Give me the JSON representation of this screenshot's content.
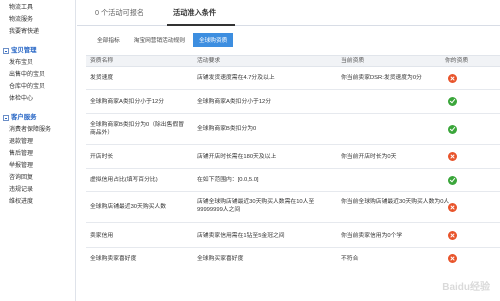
{
  "sidebar": {
    "top_items": [
      "物流工具",
      "物流服务",
      "我要寄快递"
    ],
    "sections": [
      {
        "title": "宝贝管理",
        "items": [
          "发布宝贝",
          "出售中的宝贝",
          "仓库中的宝贝",
          "体检中心"
        ]
      },
      {
        "title": "客户服务",
        "items": [
          "消费者保障服务",
          "退款管理",
          "售后管理",
          "举报管理",
          "咨询回复",
          "违规记录",
          "维权进度"
        ]
      }
    ]
  },
  "tabs": [
    {
      "label": "0 个活动可报名"
    },
    {
      "label": "活动准入条件"
    }
  ],
  "subtabs": [
    {
      "label": "全部指标"
    },
    {
      "label": "淘宝网营销活动规则"
    },
    {
      "label": "全球购资质"
    }
  ],
  "table": {
    "headers": [
      "资质名称",
      "活动要求",
      "当前资质",
      "你的资质"
    ],
    "rows": [
      {
        "name": "发货速度",
        "req": "店铺发货速度需在4.7分及以上",
        "cur": "你当前卖家DSR:发货速度为0分",
        "status": "bad"
      },
      {
        "name": "全球购商家A类扣分小于12分",
        "req": "全球购商家A类扣分小于12分",
        "cur": "",
        "status": "ok"
      },
      {
        "name": "全球购商家B类扣分为0（除出售假冒商品外）",
        "req": "全球购商家B类扣分为0",
        "cur": "",
        "status": "ok"
      },
      {
        "name": "开店时长",
        "req": "店铺开店时长需在180天及以上",
        "cur": "你当前开店时长为0天",
        "status": "bad"
      },
      {
        "name": "虚拟信用占比(填写百分比)",
        "req": "在如下范围内：[0.0,5.0]",
        "cur": "",
        "status": "ok"
      },
      {
        "name": "全球购店铺最近30天购买人数",
        "req": "店铺全球购店铺最近30天购买人数需在10人至99999999人之间",
        "cur": "你当前全球购店铺最近30天购买人数为0人",
        "status": "bad"
      },
      {
        "name": "卖家信用",
        "req": "店铺卖家信用需在1钻至5金冠之间",
        "cur": "你当前卖家信用为0个学",
        "status": "bad"
      },
      {
        "name": "全球购卖家喜好度",
        "req": "全球购买家喜好度",
        "cur": "不符合",
        "status": "bad"
      }
    ]
  },
  "watermark": "Baidu经验"
}
